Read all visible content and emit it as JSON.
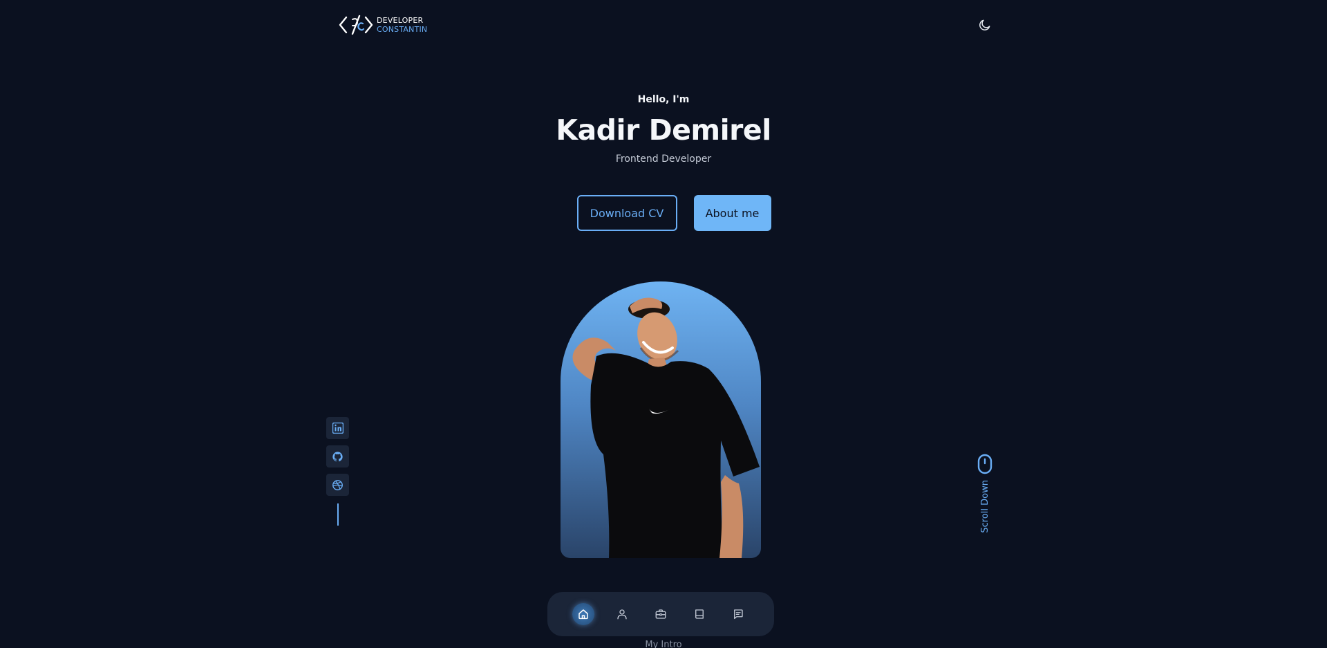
{
  "header": {
    "logo_line1": "DEVELOPER",
    "logo_line2": "CONSTANTIN",
    "theme_icon": "moon-icon"
  },
  "hero": {
    "greeting": "Hello, I'm",
    "name": "Kadir Demirel",
    "role": "Frontend Developer",
    "download_cv_label": "Download CV",
    "about_me_label": "About me"
  },
  "portrait": {
    "icon": "profile-photo",
    "shirt_logo": "swoosh-logo"
  },
  "social": {
    "items": [
      {
        "icon": "linkedin-icon"
      },
      {
        "icon": "github-icon"
      },
      {
        "icon": "dribbble-icon"
      }
    ]
  },
  "scroll": {
    "label": "Scroll Down",
    "icon": "mouse-icon"
  },
  "nav": {
    "items": [
      {
        "icon": "home-icon",
        "active": true
      },
      {
        "icon": "user-icon",
        "active": false
      },
      {
        "icon": "briefcase-icon",
        "active": false
      },
      {
        "icon": "book-icon",
        "active": false
      },
      {
        "icon": "message-icon",
        "active": false
      }
    ]
  },
  "section_caption": "My Intro",
  "colors": {
    "background": "#0b1120",
    "accent": "#6aaef6",
    "surface": "#1b2538",
    "text": "#f5f7fa"
  }
}
